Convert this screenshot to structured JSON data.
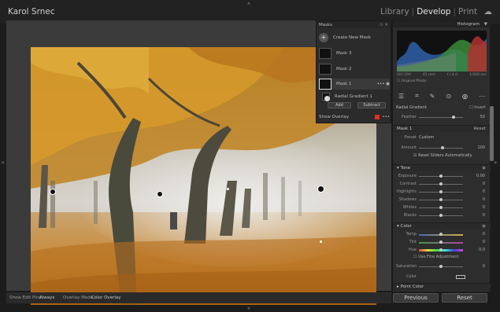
{
  "app": {
    "user_name": "Karol Srnec",
    "modules": [
      "Library",
      "Develop",
      "Print"
    ],
    "active_module": "Develop",
    "cloud_icon": "cloud-icon"
  },
  "histogram": {
    "title": "Histogram",
    "exif": [
      "ISO 200",
      "45 mm",
      "f / 4.0",
      "1/400 sec"
    ],
    "original_photo_label": "Original Photo"
  },
  "masks": {
    "title": "Masks",
    "create_label": "Create New Mask",
    "items": [
      "Mask 3",
      "Mask 2",
      "Mask 1"
    ],
    "selected_component": "Radial Gradient 1",
    "add_label": "Add",
    "subtract_label": "Subtract",
    "show_overlay_label": "Show Overlay",
    "overlay_color": "#e03020"
  },
  "panel": {
    "radial_gradient_label": "Radial Gradient",
    "invert_label": "Invert",
    "feather_label": "Feather",
    "feather_value": "50",
    "mask_label": "Mask 1",
    "reset_label": "Reset",
    "preset_label": "Preset",
    "preset_value": "Custom",
    "amount_label": "Amount",
    "amount_value": "100",
    "reset_sliders_label": "Reset Sliders Automatically",
    "tone_title": "Tone",
    "tone_rows": [
      {
        "label": "Exposure",
        "value": "0.00"
      },
      {
        "label": "Contrast",
        "value": "0"
      },
      {
        "label": "Highlights",
        "value": "0"
      },
      {
        "label": "Shadows",
        "value": "0"
      },
      {
        "label": "Whites",
        "value": "0"
      },
      {
        "label": "Blacks",
        "value": "0"
      }
    ],
    "color_title": "Color",
    "color_rows": [
      {
        "label": "Temp",
        "value": "0"
      },
      {
        "label": "Tint",
        "value": "0"
      },
      {
        "label": "Hue",
        "value": "0.0"
      }
    ],
    "fine_adjustment_label": "Use Fine Adjustment",
    "saturation_label": "Saturation",
    "saturation_value": "0",
    "color_label": "Color",
    "point_color_label": "Point Color"
  },
  "bottom": {
    "show_edit_pins_label": "Show Edit Pins :",
    "show_edit_pins_value": "Always",
    "overlay_mode_label": "Overlay Mode :",
    "overlay_mode_value": "Color Overlay",
    "previous_label": "Previous",
    "reset_label": "Reset"
  }
}
